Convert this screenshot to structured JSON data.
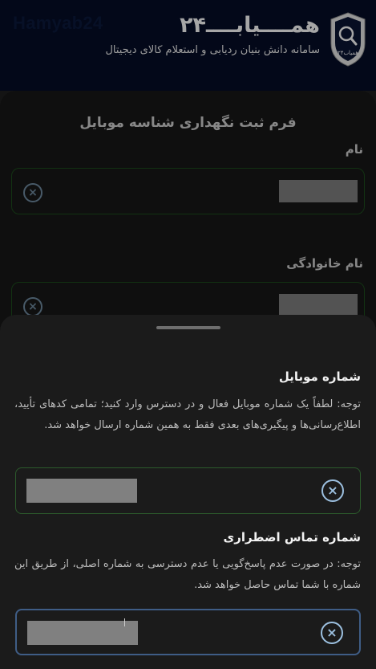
{
  "header": {
    "watermark": "Hamyab24",
    "brand": "همــــیابــــ۲۴",
    "tagline": "سامانه دانش بنیان ردیابی و استعلام کالای دیجیتال",
    "logo_text": "همیاب۲۴"
  },
  "form": {
    "title": "فرم ثبت نگهداری شناسه موبایل",
    "fields": [
      {
        "label": "نام"
      },
      {
        "label": "نام خانوادگی"
      }
    ]
  },
  "sheet": {
    "mobile": {
      "title": "شماره موبایل",
      "note": "توجه: لطفاً یک شماره موبایل فعال و در دسترس وارد کنید؛ تمامی کدهای تأیید، اطلاع‌رسانی‌ها و پیگیری‌های بعدی فقط به همین شماره ارسال خواهد شد."
    },
    "emergency": {
      "title": "شماره تماس اضطراری",
      "note": "توجه: در صورت عدم پاسخ‌گویی یا عدم دسترسی به شماره اصلی، از طریق این شماره با شما تماس حاصل خواهد شد."
    }
  },
  "icons": {
    "clear": "×",
    "logo": "shield-search-icon"
  },
  "colors": {
    "header_bg": "#050d27",
    "focus_border": "#3f5d86",
    "field_border": "#2c5a2c",
    "clear_icon": "#9cc0e0"
  }
}
